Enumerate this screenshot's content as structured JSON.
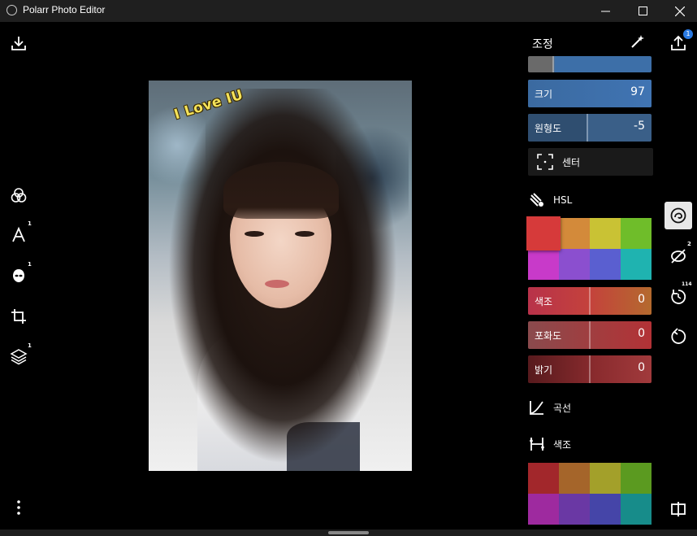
{
  "window": {
    "title": "Polarr Photo Editor"
  },
  "photo": {
    "sticker_text": "I Love IU"
  },
  "left_toolbar": {
    "items": [
      {
        "icon": "download-icon"
      },
      {
        "icon": "filters-icon"
      },
      {
        "icon": "text-icon",
        "badge": "1"
      },
      {
        "icon": "face-icon",
        "badge": "1"
      },
      {
        "icon": "crop-icon"
      },
      {
        "icon": "layers-icon",
        "badge": "1"
      },
      {
        "icon": "more-icon"
      }
    ]
  },
  "panel": {
    "title": "조정",
    "sliders_top": [
      {
        "label": "크기",
        "value": "97",
        "fill": 0.97,
        "color": "#3d6fa8"
      },
      {
        "label": "원형도",
        "value": "-5",
        "fill": 0.475,
        "color": "#3d6fa8"
      }
    ],
    "center_button": "센터",
    "hsl": {
      "title": "HSL",
      "swatches": [
        "#d63a3a",
        "#d38a3a",
        "#c9c234",
        "#6fbd2a",
        "#c83ac9",
        "#8b4fcf",
        "#5a5fd0",
        "#1fb3b0"
      ]
    },
    "hsl_sliders": [
      {
        "label": "색조",
        "value": "0"
      },
      {
        "label": "포화도",
        "value": "0"
      },
      {
        "label": "밝기",
        "value": "0"
      }
    ],
    "curves": {
      "label": "곡선"
    },
    "color_tone": {
      "label": "색조",
      "swatches": [
        "#a2272b",
        "#a5652a",
        "#a3a02a",
        "#5b9a20",
        "#9e2a9f",
        "#6a38a4",
        "#4545a8",
        "#178c8a"
      ]
    }
  },
  "right_toolbar": {
    "share_badge": "1",
    "heal_badge": "2",
    "history_badge": "114"
  }
}
